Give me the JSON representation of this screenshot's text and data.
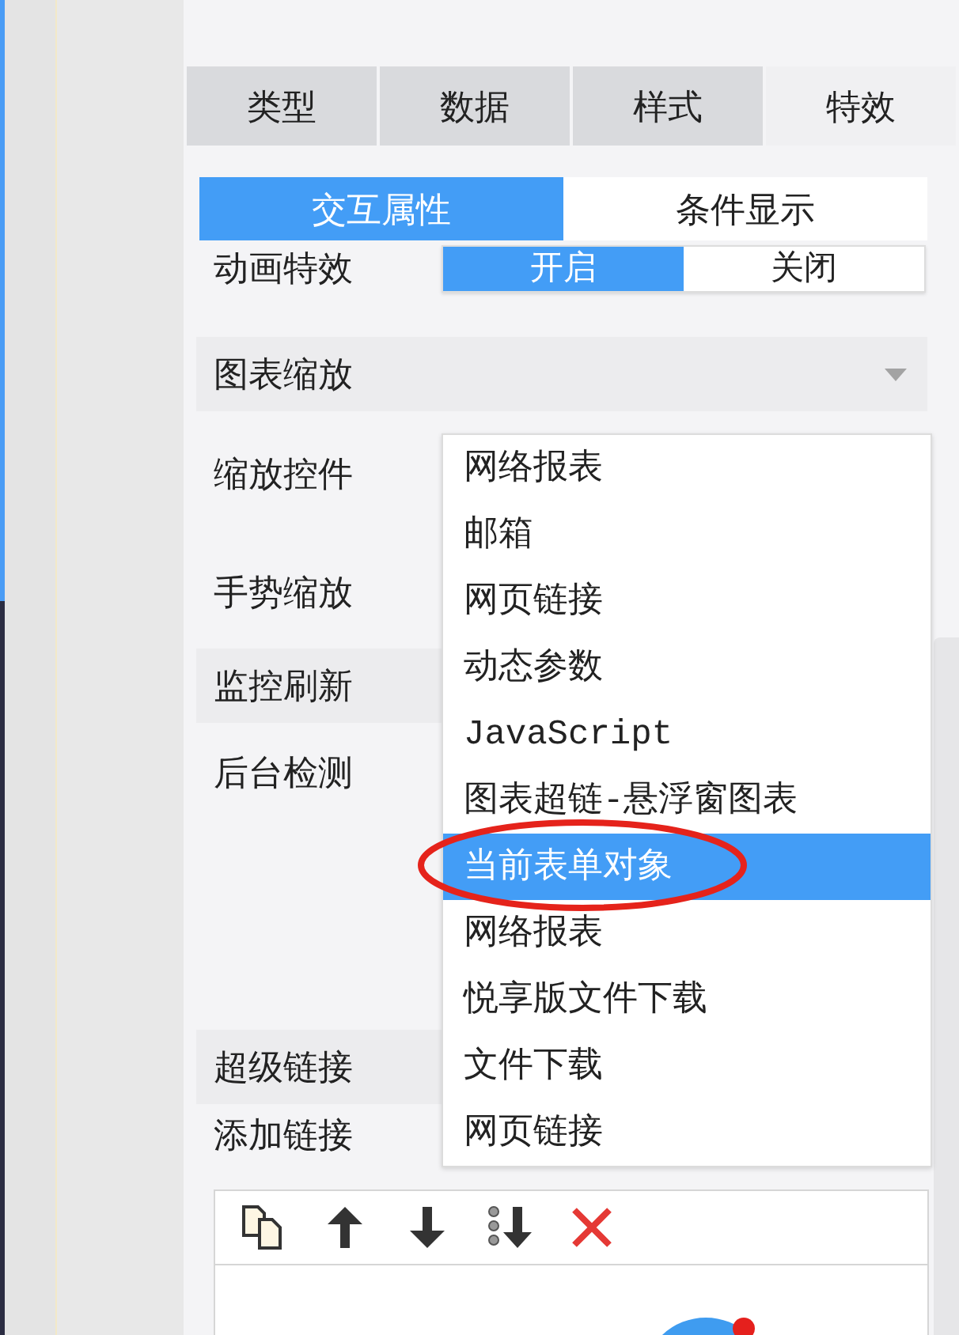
{
  "tabs": [
    {
      "label": "类型",
      "selected": false
    },
    {
      "label": "数据",
      "selected": false
    },
    {
      "label": "样式",
      "selected": false
    },
    {
      "label": "特效",
      "selected": true
    }
  ],
  "sub_tabs": [
    {
      "label": "交互属性",
      "selected": true
    },
    {
      "label": "条件显示",
      "selected": false
    }
  ],
  "animation_effect": {
    "label": "动画特效",
    "options": [
      {
        "label": "开启",
        "selected": true
      },
      {
        "label": "关闭",
        "selected": false
      }
    ]
  },
  "sections": [
    {
      "title": "图表缩放",
      "caret": true,
      "rows": [
        {
          "label": "缩放控件"
        },
        {
          "label": "手势缩放"
        }
      ]
    },
    {
      "title": "监控刷新",
      "rows": [
        {
          "label": "后台检测"
        }
      ]
    },
    {
      "title": "超级链接",
      "rows": [
        {
          "label": "添加链接"
        }
      ]
    }
  ],
  "dropdown": {
    "items": [
      {
        "label": "网络报表",
        "selected": false
      },
      {
        "label": "邮箱",
        "selected": false
      },
      {
        "label": "网页链接",
        "selected": false
      },
      {
        "label": "动态参数",
        "selected": false
      },
      {
        "label": "JavaScript",
        "selected": false
      },
      {
        "label": "图表超链-悬浮窗图表",
        "selected": false
      },
      {
        "label": "当前表单对象",
        "selected": true
      },
      {
        "label": "网络报表",
        "selected": false
      },
      {
        "label": "悦享版文件下载",
        "selected": false
      },
      {
        "label": "文件下载",
        "selected": false
      },
      {
        "label": "网页链接",
        "selected": false
      }
    ]
  }
}
